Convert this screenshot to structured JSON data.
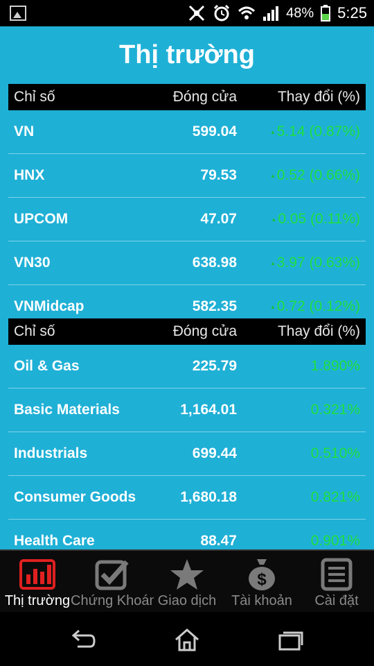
{
  "status_bar": {
    "battery": "48%",
    "time": "5:25"
  },
  "title": "Thị trường",
  "indices_table": {
    "headers": [
      "Chỉ số",
      "Đóng cửa",
      "Thay đổi (%)"
    ],
    "rows": [
      {
        "name": "VN",
        "close": "599.04",
        "change": "5.14 (0.87%)"
      },
      {
        "name": "HNX",
        "close": "79.53",
        "change": "0.52 (0.66%)"
      },
      {
        "name": "UPCOM",
        "close": "47.07",
        "change": "0.05 (0.11%)"
      },
      {
        "name": "VN30",
        "close": "638.98",
        "change": "3.97 (0.63%)"
      },
      {
        "name": "VNMidcap",
        "close": "582.35",
        "change": "0.72 (0.12%)"
      }
    ]
  },
  "sectors_table": {
    "headers": [
      "Chỉ số",
      "Đóng cửa",
      "Thay đổi (%)"
    ],
    "rows": [
      {
        "name": "Oil & Gas",
        "close": "225.79",
        "change": "1.890%"
      },
      {
        "name": "Basic Materials",
        "close": "1,164.01",
        "change": "0.321%"
      },
      {
        "name": "Industrials",
        "close": "699.44",
        "change": "0.510%"
      },
      {
        "name": "Consumer Goods",
        "close": "1,680.18",
        "change": "0.821%"
      },
      {
        "name": "Health Care",
        "close": "88.47",
        "change": "0.901%"
      }
    ]
  },
  "tabs": [
    {
      "label": "Thị trường",
      "icon": "bar-chart-icon",
      "active": true
    },
    {
      "label": "Chứng Khoán",
      "icon": "checkbox-icon",
      "active": false
    },
    {
      "label": "Giao dịch",
      "icon": "star-icon",
      "active": false
    },
    {
      "label": "Tài khoản",
      "icon": "money-bag-icon",
      "active": false
    },
    {
      "label": "Cài đặt",
      "icon": "list-icon",
      "active": false
    }
  ],
  "colors": {
    "background": "#1fb0d6",
    "positive": "#1ee040",
    "active_tab": "#e02020"
  }
}
